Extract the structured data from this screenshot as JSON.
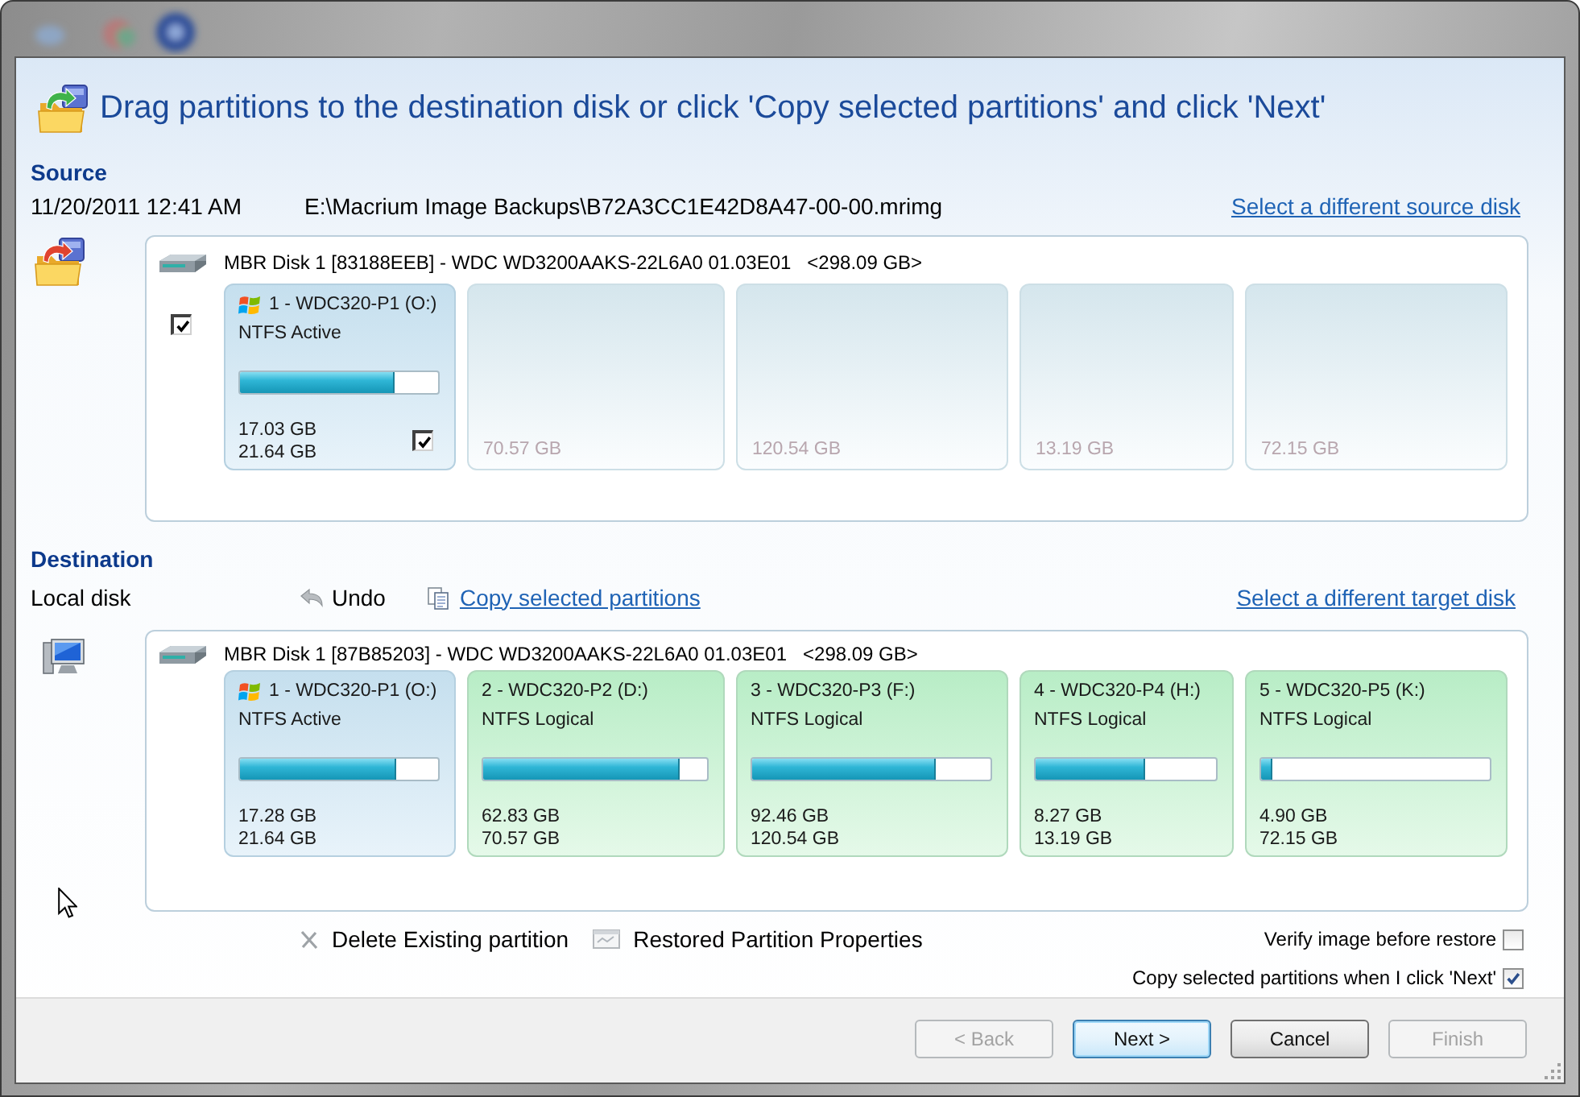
{
  "window": {
    "heading": "Drag partitions to the destination disk or click 'Copy selected partitions' and click 'Next'"
  },
  "source": {
    "title": "Source",
    "date": "11/20/2011 12:41 AM",
    "path": "E:\\Macrium Image Backups\\B72A3CC1E42D8A47-00-00.mrimg",
    "link": "Select a different source disk",
    "disk": {
      "label": "MBR Disk 1 [83188EEB] - WDC WD3200AAKS-22L6A0 01.03E01",
      "size": "<298.09 GB>",
      "checked": true,
      "partitions": [
        {
          "kind": "original",
          "windows_logo": true,
          "name": "1 - WDC320-P1 (O:)",
          "type": "NTFS Active",
          "level": 0.78,
          "used": "17.03 GB",
          "total": "21.64 GB",
          "checked": true
        },
        {
          "kind": "blank",
          "total": "70.57 GB"
        },
        {
          "kind": "blank",
          "total": "120.54 GB"
        },
        {
          "kind": "blank",
          "total": "13.19 GB"
        },
        {
          "kind": "blank",
          "total": "72.15 GB"
        }
      ]
    }
  },
  "destination": {
    "title": "Destination",
    "subtitle": "Local disk",
    "undo": "Undo",
    "copy_link": "Copy selected partitions",
    "link": "Select a different target disk",
    "disk": {
      "label": "MBR Disk 1 [87B85203] - WDC WD3200AAKS-22L6A0 01.03E01",
      "size": "<298.09 GB>",
      "partitions": [
        {
          "kind": "original",
          "windows_logo": true,
          "name": "1 - WDC320-P1 (O:)",
          "type": "NTFS Active",
          "level": 0.79,
          "used": "17.28 GB",
          "total": "21.64 GB"
        },
        {
          "kind": "copied",
          "windows_logo": false,
          "name": "2 - WDC320-P2 (D:)",
          "type": "NTFS Logical",
          "level": 0.88,
          "used": "62.83 GB",
          "total": "70.57 GB"
        },
        {
          "kind": "copied",
          "windows_logo": false,
          "name": "3 - WDC320-P3 (F:)",
          "type": "NTFS Logical",
          "level": 0.77,
          "used": "92.46 GB",
          "total": "120.54 GB"
        },
        {
          "kind": "copied",
          "windows_logo": false,
          "name": "4 - WDC320-P4 (H:)",
          "type": "NTFS Logical",
          "level": 0.61,
          "used": "8.27 GB",
          "total": "13.19 GB"
        },
        {
          "kind": "copied",
          "windows_logo": false,
          "name": "5 - WDC320-P5 (K:)",
          "type": "NTFS Logical",
          "level": 0.05,
          "used": "4.90 GB",
          "total": "72.15 GB"
        }
      ]
    }
  },
  "actions": [
    {
      "kind": "delete",
      "label": "Delete Existing partition"
    },
    {
      "kind": "properties",
      "label": "Restored Partition Properties"
    }
  ],
  "options": [
    {
      "label": "Verify image before restore",
      "checked": false
    },
    {
      "label": "Copy selected partitions when I click 'Next'",
      "checked": true
    }
  ],
  "buttons": [
    {
      "label": "< Back",
      "disabled": true,
      "default": false
    },
    {
      "label": "Next >",
      "disabled": false,
      "default": true
    },
    {
      "label": "Cancel",
      "disabled": false,
      "default": false
    },
    {
      "label": "Finish",
      "disabled": true,
      "default": false
    }
  ]
}
